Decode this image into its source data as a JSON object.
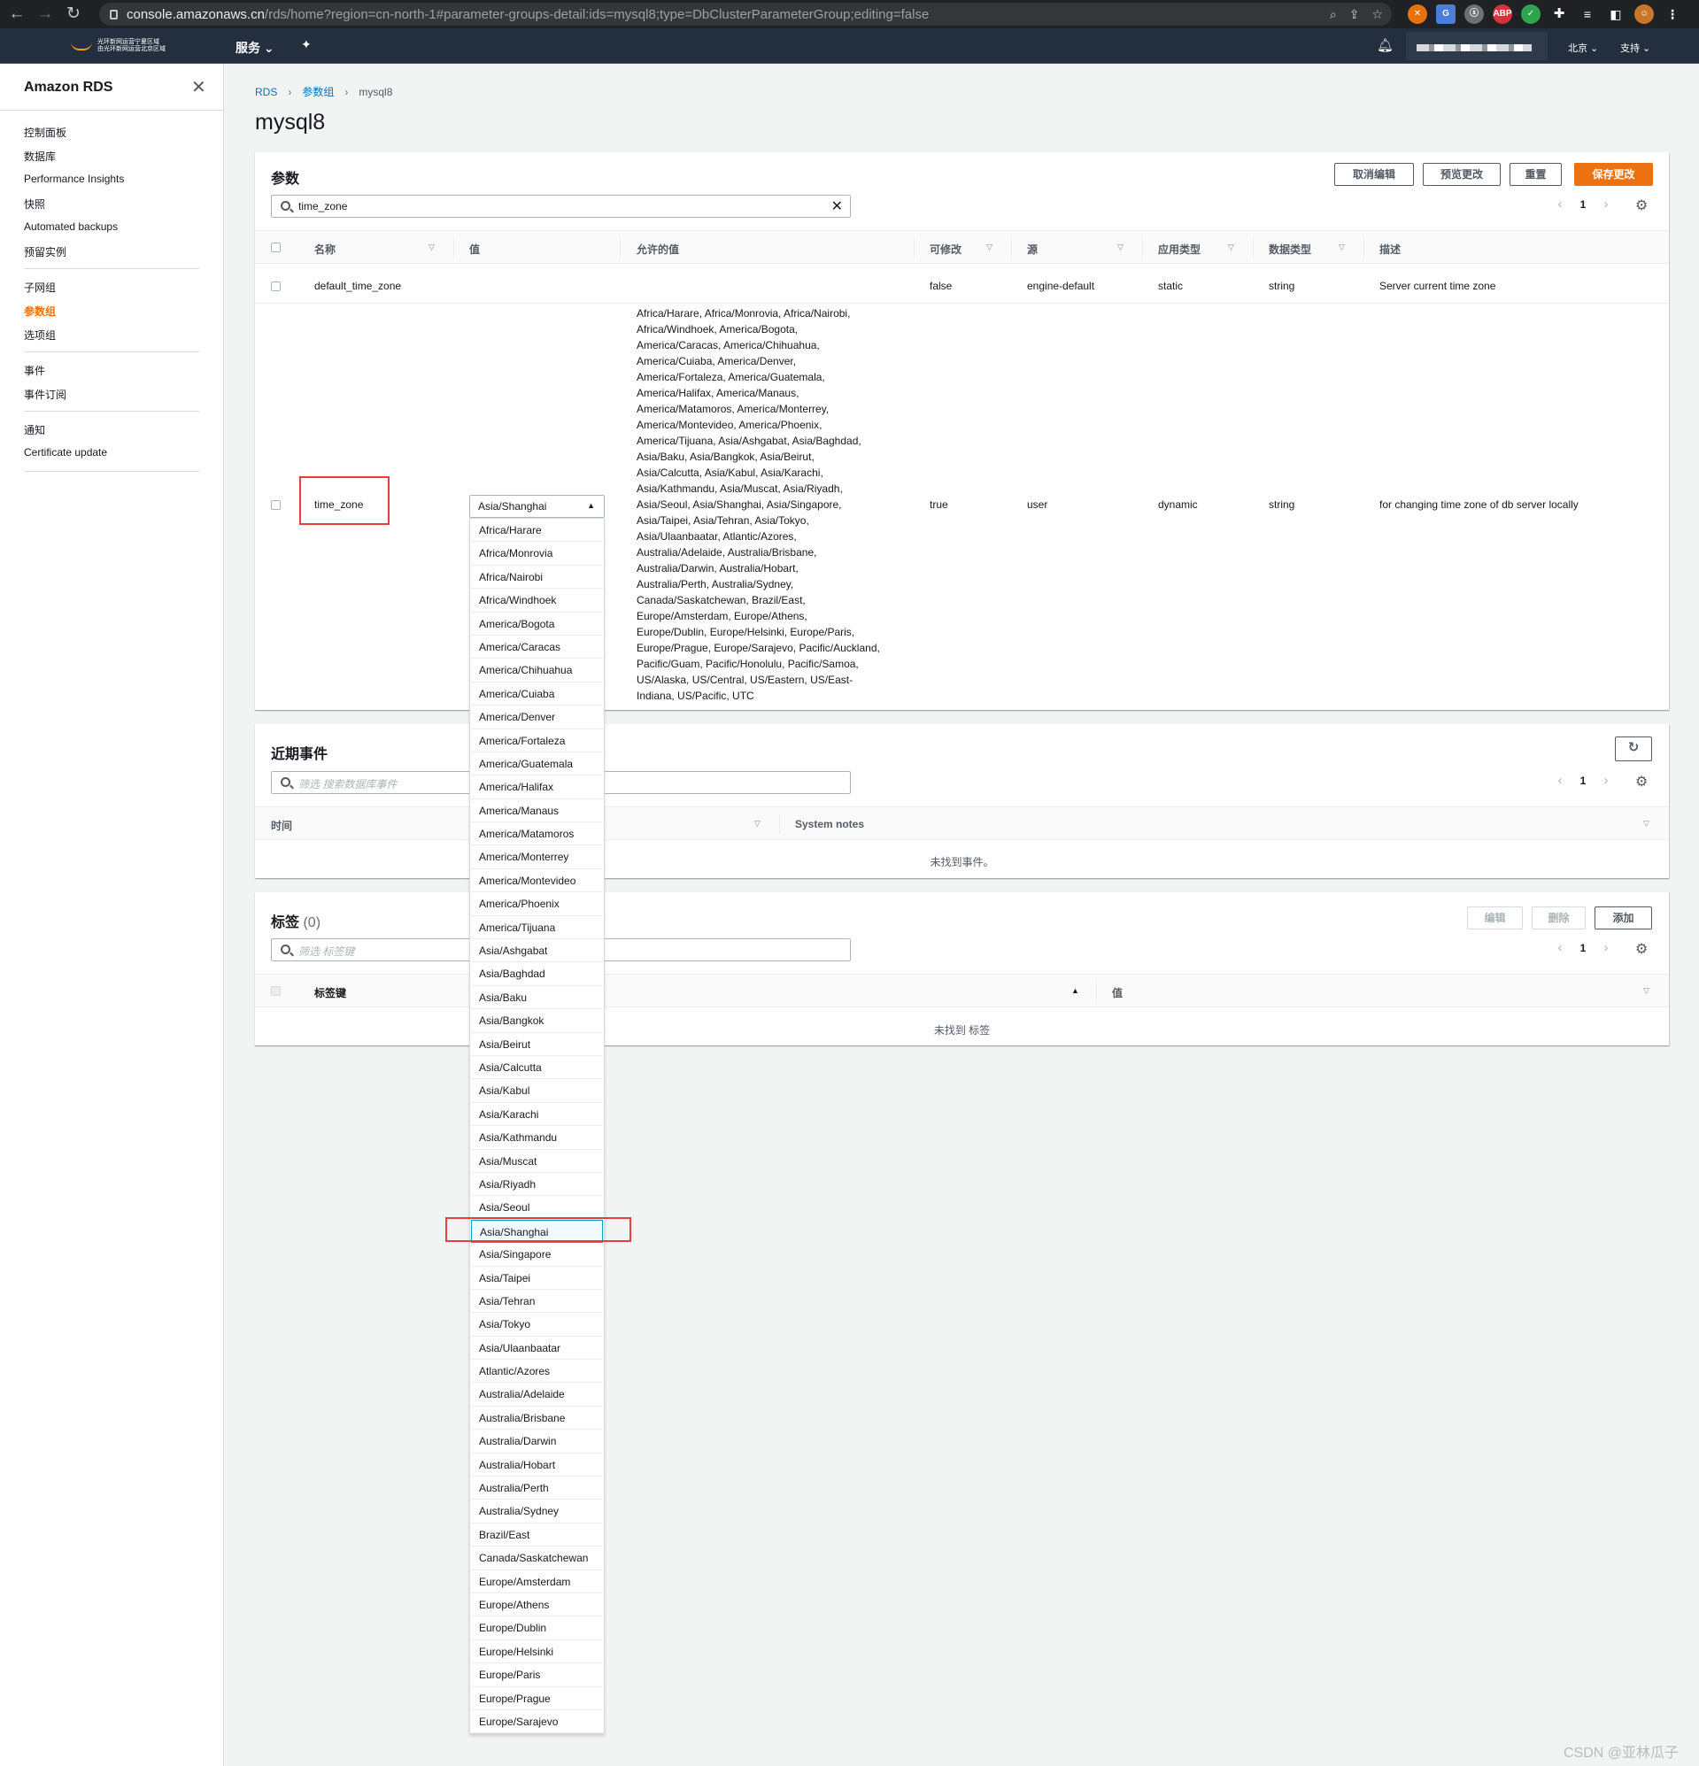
{
  "browser": {
    "url_host": "console.amazonaws.cn",
    "url_path": "/rds/home?region=cn-north-1#parameter-groups-detail:ids=mysql8;type=DbClusterParameterGroup;editing=false"
  },
  "header": {
    "logo_line1": "光环新网运营宁夏区域",
    "logo_line2": "由光环新网运营北京区域",
    "services_label": "服务",
    "region_label": "北京",
    "support_label": "支持"
  },
  "sidebar": {
    "title": "Amazon RDS",
    "groups": [
      [
        "控制面板",
        "数据库",
        "Performance Insights",
        "快照",
        "Automated backups",
        "预留实例"
      ],
      [
        "子网组",
        "参数组",
        "选项组"
      ],
      [
        "事件",
        "事件订阅"
      ],
      [
        "通知",
        "Certificate update"
      ]
    ],
    "active_item": "参数组"
  },
  "breadcrumb": [
    "RDS",
    "参数组",
    "mysql8"
  ],
  "page_title": "mysql8",
  "params_panel": {
    "title": "参数",
    "buttons": {
      "cancel": "取消编辑",
      "preview": "预览更改",
      "reset": "重置",
      "save": "保存更改"
    },
    "search_value": "time_zone",
    "page_number": "1",
    "columns": [
      "名称",
      "值",
      "允许的值",
      "可修改",
      "源",
      "应用类型",
      "数据类型",
      "描述"
    ],
    "rows": [
      {
        "name": "default_time_zone",
        "value": "",
        "allowed_values": "",
        "modifiable": "false",
        "source": "engine-default",
        "apply_type": "static",
        "data_type": "string",
        "description": "Server current time zone"
      },
      {
        "name": "time_zone",
        "value": "Asia/Shanghai",
        "allowed_lines": [
          "Africa/Harare, Africa/Monrovia, Africa/Nairobi,",
          "Africa/Windhoek, America/Bogota,",
          "America/Caracas, America/Chihuahua,",
          "America/Cuiaba, America/Denver,",
          "America/Fortaleza, America/Guatemala,",
          "America/Halifax, America/Manaus,",
          "America/Matamoros, America/Monterrey,",
          "America/Montevideo, America/Phoenix,",
          "America/Tijuana, Asia/Ashgabat, Asia/Baghdad,",
          "Asia/Baku, Asia/Bangkok, Asia/Beirut,",
          "Asia/Calcutta, Asia/Kabul, Asia/Karachi,",
          "Asia/Kathmandu, Asia/Muscat, Asia/Riyadh,",
          "Asia/Seoul, Asia/Shanghai, Asia/Singapore,",
          "Asia/Taipei, Asia/Tehran, Asia/Tokyo,",
          "Asia/Ulaanbaatar, Atlantic/Azores,",
          "Australia/Adelaide, Australia/Brisbane,",
          "Australia/Darwin, Australia/Hobart,",
          "Australia/Perth, Australia/Sydney,",
          "Canada/Saskatchewan, Brazil/East,",
          "Europe/Amsterdam, Europe/Athens,",
          "Europe/Dublin, Europe/Helsinki, Europe/Paris,",
          "Europe/Prague, Europe/Sarajevo, Pacific/Auckland,",
          "Pacific/Guam, Pacific/Honolulu, Pacific/Samoa,",
          "US/Alaska, US/Central, US/Eastern, US/East-",
          "Indiana, US/Pacific, UTC"
        ],
        "modifiable": "true",
        "source": "user",
        "apply_type": "dynamic",
        "data_type": "string",
        "description": "for changing time zone of db server locally"
      }
    ]
  },
  "dropdown": {
    "selected": "Asia/Shanghai",
    "options": [
      "Africa/Harare",
      "Africa/Monrovia",
      "Africa/Nairobi",
      "Africa/Windhoek",
      "America/Bogota",
      "America/Caracas",
      "America/Chihuahua",
      "America/Cuiaba",
      "America/Denver",
      "America/Fortaleza",
      "America/Guatemala",
      "America/Halifax",
      "America/Manaus",
      "America/Matamoros",
      "America/Monterrey",
      "America/Montevideo",
      "America/Phoenix",
      "America/Tijuana",
      "Asia/Ashgabat",
      "Asia/Baghdad",
      "Asia/Baku",
      "Asia/Bangkok",
      "Asia/Beirut",
      "Asia/Calcutta",
      "Asia/Kabul",
      "Asia/Karachi",
      "Asia/Kathmandu",
      "Asia/Muscat",
      "Asia/Riyadh",
      "Asia/Seoul",
      "Asia/Shanghai",
      "Asia/Singapore",
      "Asia/Taipei",
      "Asia/Tehran",
      "Asia/Tokyo",
      "Asia/Ulaanbaatar",
      "Atlantic/Azores",
      "Australia/Adelaide",
      "Australia/Brisbane",
      "Australia/Darwin",
      "Australia/Hobart",
      "Australia/Perth",
      "Australia/Sydney",
      "Brazil/East",
      "Canada/Saskatchewan",
      "Europe/Amsterdam",
      "Europe/Athens",
      "Europe/Dublin",
      "Europe/Helsinki",
      "Europe/Paris",
      "Europe/Prague",
      "Europe/Sarajevo"
    ]
  },
  "events_panel": {
    "title": "近期事件",
    "search_placeholder": "筛选 搜索数据库事件",
    "page_number": "1",
    "columns": [
      "时间",
      "System notes"
    ],
    "empty_text": "未找到事件。"
  },
  "tags_panel": {
    "title": "标签",
    "count": "(0)",
    "buttons": {
      "edit": "编辑",
      "delete": "删除",
      "add": "添加"
    },
    "search_placeholder": "筛选 标签键",
    "page_number": "1",
    "columns": [
      "标签键",
      "值"
    ],
    "empty_text": "未找到 标签"
  },
  "watermark": "CSDN @亚林瓜子",
  "colors": {
    "accent": "#ec7211",
    "link": "#0073bb",
    "highlight": "#e53e3e"
  }
}
